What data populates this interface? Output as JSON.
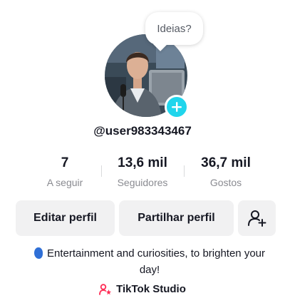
{
  "bubble": {
    "text": "Ideias?"
  },
  "profile": {
    "username": "@user983343467"
  },
  "stats": [
    {
      "value": "7",
      "label": "A seguir"
    },
    {
      "value": "13,6 mil",
      "label": "Seguidores"
    },
    {
      "value": "36,7 mil",
      "label": "Gostos"
    }
  ],
  "buttons": {
    "edit_label": "Editar perfil",
    "share_label": "Partilhar perfil",
    "add_friend_icon": "add-friend-icon"
  },
  "bio": {
    "emoji_icon": "blue-emoji-icon",
    "text": "Entertainment and curiosities, to brighten your day!"
  },
  "studio": {
    "icon": "tiktok-studio-icon",
    "label": "TikTok Studio"
  },
  "colors": {
    "accent_add": "#20d5ec",
    "studio_icon": "#fe2c55",
    "button_bg": "#f1f1f2",
    "text_primary": "#161823",
    "text_secondary": "#8a8b91"
  }
}
